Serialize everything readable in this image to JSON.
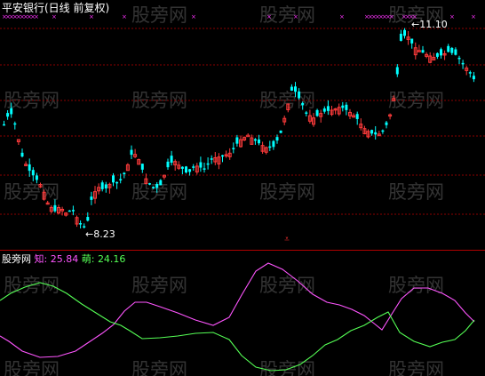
{
  "window_title": "平安银行(日线 前复权)",
  "watermark_text": "股旁网",
  "main_chart": {
    "high_label": "11.10",
    "low_label": "8.23",
    "up_color": "#ff3b3b",
    "down_color": "#00ffff",
    "grid_color": "#8b0000",
    "marker_color": "#ff33ff"
  },
  "indicator": {
    "name": "股旁网",
    "line_a_label": "知:",
    "line_a_value": "25.84",
    "line_a_color": "#ff55ff",
    "line_b_label": "萌:",
    "line_b_value": "24.16",
    "line_b_color": "#55ff55"
  },
  "bottom_marker": "⩡"
}
